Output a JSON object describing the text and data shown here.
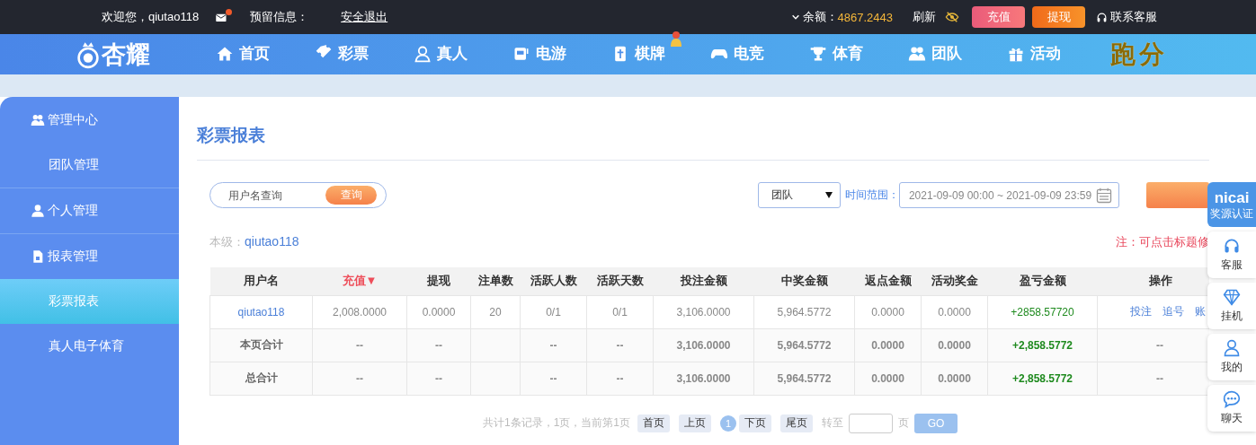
{
  "top_bar": {
    "welcome": "欢迎您，qiutao118",
    "mail_unread": true,
    "message_label": "预留信息：",
    "logout": "安全退出",
    "balance_label": "余额：",
    "balance": "4867.2443",
    "refresh": "刷新",
    "buttons": [
      {
        "label": "充值",
        "kind": "deposit"
      },
      {
        "label": "提现",
        "kind": "withdraw"
      }
    ],
    "support": "联系客服"
  },
  "nav": {
    "logo": "杏耀",
    "items": [
      {
        "label": "首页"
      },
      {
        "label": "彩票"
      },
      {
        "label": "真人"
      },
      {
        "label": "电游"
      },
      {
        "label": "棋牌",
        "hot": true
      },
      {
        "label": "电竞"
      },
      {
        "label": "体育"
      },
      {
        "label": "团队"
      },
      {
        "label": "活动"
      }
    ],
    "promo": "跑分"
  },
  "sidebar": {
    "groups": [
      {
        "label": "管理中心",
        "children": [
          {
            "label": "团队管理",
            "selected": false
          }
        ]
      },
      {
        "label": "个人管理"
      },
      {
        "label": "报表管理",
        "children": [
          {
            "label": "彩票报表",
            "selected": true
          },
          {
            "label": "真人电子体育",
            "selected": false
          }
        ]
      }
    ]
  },
  "page_title": "彩票报表",
  "filter": {
    "search_placeholder": "用户名查询",
    "search_button": "查询",
    "scope": "团队",
    "range_label": "时间范围：",
    "range": "2021-09-09 00:00 ~ 2021-09-09 23:59"
  },
  "level_label": "本级：",
  "level_user": "qiutao118",
  "note": "注：可点击标题修",
  "table": {
    "columns": [
      {
        "label": "用户名",
        "sorted": false
      },
      {
        "label": "充值▼",
        "sorted": true
      },
      {
        "label": "提现",
        "sorted": false
      },
      {
        "label": "注单数",
        "sorted": false
      },
      {
        "label": "活跃人数",
        "sorted": false
      },
      {
        "label": "活跃天数",
        "sorted": false
      },
      {
        "label": "投注金额",
        "sorted": false
      },
      {
        "label": "中奖金额",
        "sorted": false
      },
      {
        "label": "返点金额",
        "sorted": false
      },
      {
        "label": "活动奖金",
        "sorted": false
      },
      {
        "label": "盈亏金额",
        "sorted": false
      },
      {
        "label": "操作",
        "sorted": false
      }
    ],
    "rows": [
      {
        "kind": "data",
        "cells": [
          "qiutao118",
          "2,008.0000",
          "0.0000",
          "20",
          "0/1",
          "0/1",
          "3,106.0000",
          "5,964.5772",
          "0.0000",
          "0.0000",
          "+2858.57720"
        ],
        "actions": [
          "投注",
          "追号",
          "账"
        ]
      },
      {
        "kind": "total",
        "cells": [
          "本页合计",
          "--",
          "--",
          null,
          "--",
          "--",
          "3,106.0000",
          "5,964.5772",
          "0.0000",
          "0.0000",
          "+2,858.5772"
        ],
        "actions_text": "--"
      },
      {
        "kind": "total",
        "cells": [
          "总合计",
          "--",
          "--",
          null,
          "--",
          "--",
          "3,106.0000",
          "5,964.5772",
          "0.0000",
          "0.0000",
          "+2,858.5772"
        ],
        "actions_text": "--"
      }
    ]
  },
  "pagination": {
    "summary": "共计1条记录，1页，当前第1页",
    "pages": [
      {
        "label": "首页",
        "kind": "nav"
      },
      {
        "label": "上页",
        "kind": "nav"
      },
      {
        "label": "1",
        "kind": "page",
        "selected": true
      },
      {
        "label": "下页",
        "kind": "nav"
      },
      {
        "label": "尾页",
        "kind": "nav"
      }
    ],
    "goto_label": "转至",
    "page_unit": "页",
    "go": "GO"
  },
  "side_panel": {
    "badge_brand": "nicai",
    "badge_caption": "奖源认证",
    "items": [
      {
        "label": "客服"
      },
      {
        "label": "挂机"
      },
      {
        "label": "我的"
      },
      {
        "label": "聊天"
      }
    ]
  }
}
